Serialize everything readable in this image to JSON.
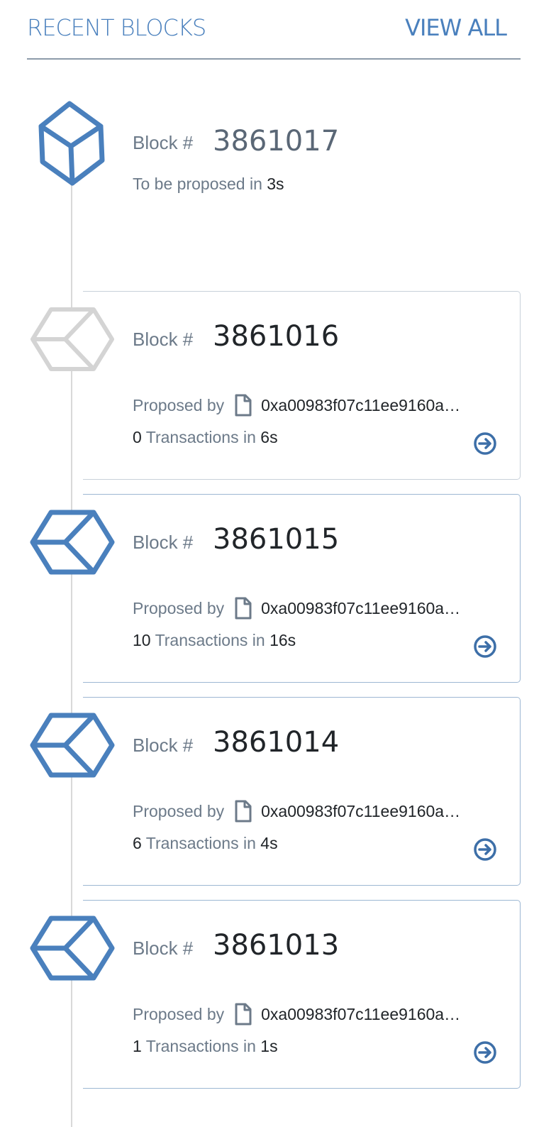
{
  "header": {
    "title": "RECENT BLOCKS",
    "view_all": "VIEW ALL"
  },
  "colors": {
    "accent": "#4a80bd",
    "muted": "#6c7a89",
    "inactive_icon": "#d4d4d4"
  },
  "pending_block": {
    "label": "Block #",
    "number": "3861017",
    "status_prefix": "To be proposed in",
    "status_time": "3s",
    "icon": "cube-icon"
  },
  "blocks": [
    {
      "label": "Block #",
      "number": "3861016",
      "proposed_by_label": "Proposed by",
      "proposer": "0xa00983f07c11ee9160a…",
      "tx_count": "0",
      "tx_label": "Transactions in",
      "time": "6s",
      "icon": "block-icon-inactive"
    },
    {
      "label": "Block #",
      "number": "3861015",
      "proposed_by_label": "Proposed by",
      "proposer": "0xa00983f07c11ee9160a…",
      "tx_count": "10",
      "tx_label": "Transactions in",
      "time": "16s",
      "icon": "block-icon"
    },
    {
      "label": "Block #",
      "number": "3861014",
      "proposed_by_label": "Proposed by",
      "proposer": "0xa00983f07c11ee9160a…",
      "tx_count": "6",
      "tx_label": "Transactions in",
      "time": "4s",
      "icon": "block-icon"
    },
    {
      "label": "Block #",
      "number": "3861013",
      "proposed_by_label": "Proposed by",
      "proposer": "0xa00983f07c11ee9160a…",
      "tx_count": "1",
      "tx_label": "Transactions in",
      "time": "1s",
      "icon": "block-icon"
    }
  ]
}
